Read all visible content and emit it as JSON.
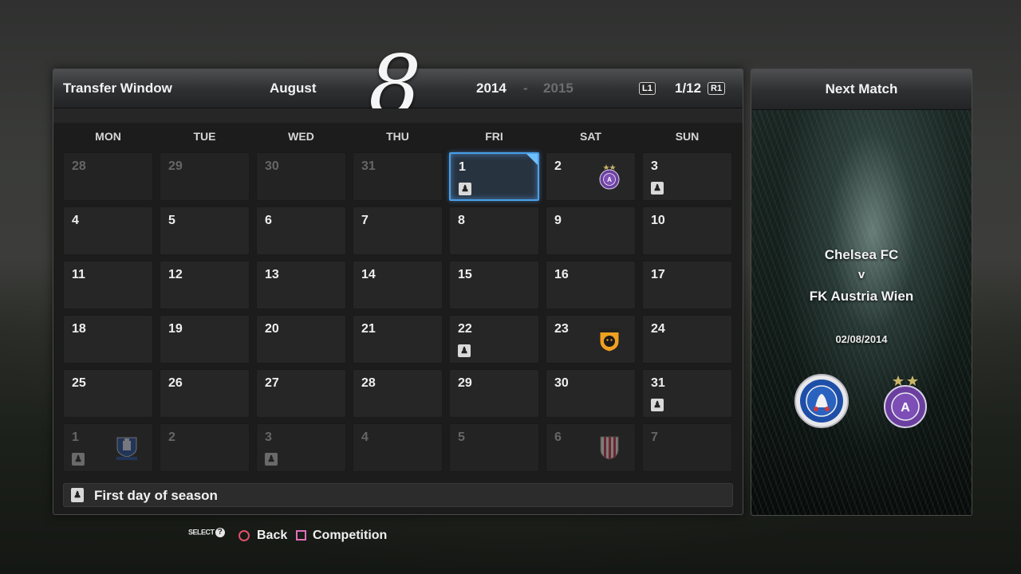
{
  "calendar": {
    "title": "Transfer Window",
    "month_name": "August",
    "month_number": "8",
    "year_start": "2014",
    "year_separator": "-",
    "year_end": "2015",
    "l1_label": "L1",
    "r1_label": "R1",
    "page": "1/12",
    "weekdays": [
      "MON",
      "TUE",
      "WED",
      "THU",
      "FRI",
      "SAT",
      "SUN"
    ],
    "weeks": [
      [
        {
          "day": "28",
          "other_month": true
        },
        {
          "day": "29",
          "other_month": true
        },
        {
          "day": "30",
          "other_month": true
        },
        {
          "day": "31",
          "other_month": true
        },
        {
          "day": "1",
          "selected": true,
          "event": true
        },
        {
          "day": "2",
          "crest": "austria-wien-crest"
        },
        {
          "day": "3",
          "event": true
        }
      ],
      [
        {
          "day": "4"
        },
        {
          "day": "5"
        },
        {
          "day": "6"
        },
        {
          "day": "7"
        },
        {
          "day": "8"
        },
        {
          "day": "9"
        },
        {
          "day": "10"
        }
      ],
      [
        {
          "day": "11"
        },
        {
          "day": "12"
        },
        {
          "day": "13"
        },
        {
          "day": "14"
        },
        {
          "day": "15"
        },
        {
          "day": "16"
        },
        {
          "day": "17"
        }
      ],
      [
        {
          "day": "18"
        },
        {
          "day": "19"
        },
        {
          "day": "20"
        },
        {
          "day": "21"
        },
        {
          "day": "22",
          "event": true
        },
        {
          "day": "23",
          "crest": "hull-city-crest"
        },
        {
          "day": "24"
        }
      ],
      [
        {
          "day": "25"
        },
        {
          "day": "26"
        },
        {
          "day": "27"
        },
        {
          "day": "28"
        },
        {
          "day": "29"
        },
        {
          "day": "30"
        },
        {
          "day": "31",
          "event": true
        }
      ],
      [
        {
          "day": "1",
          "other_month": true,
          "event": true,
          "crest": "everton-crest"
        },
        {
          "day": "2",
          "other_month": true
        },
        {
          "day": "3",
          "other_month": true,
          "event": true
        },
        {
          "day": "4",
          "other_month": true
        },
        {
          "day": "5",
          "other_month": true
        },
        {
          "day": "6",
          "other_month": true,
          "crest": "stoke-city-crest"
        },
        {
          "day": "7",
          "other_month": true
        }
      ]
    ],
    "event_icon": "event-marker-icon",
    "info_text": "First day of season"
  },
  "next_match": {
    "title": "Next Match",
    "home_team": "Chelsea FC",
    "versus": "v",
    "away_team": "FK Austria Wien",
    "date": "02/08/2014",
    "home_crest": "chelsea-crest",
    "away_crest": "austria-wien-crest"
  },
  "footer": {
    "select_label": "SELECT",
    "help_glyph": "?",
    "back_label": "Back",
    "competition_label": "Competition"
  },
  "colors": {
    "selection": "#4aa0e8",
    "circle_button": "#e0506a",
    "square_button": "#e070b8"
  }
}
